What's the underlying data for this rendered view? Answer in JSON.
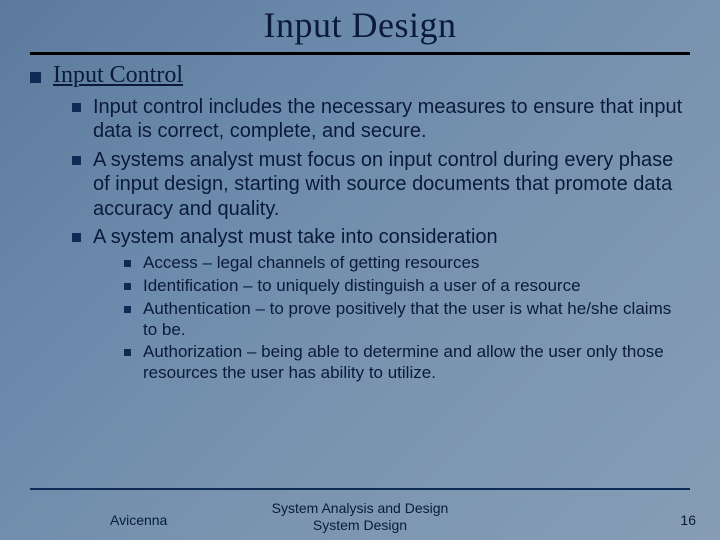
{
  "title": "Input Design",
  "section": "Input Control",
  "bullets": [
    "Input control includes the necessary measures to ensure that input data is correct, complete, and secure.",
    " A systems analyst must focus on input control during every phase of input design, starting with source documents that promote data accuracy and quality.",
    "A system analyst must take into consideration"
  ],
  "subbullets": [
    "Access – legal channels of getting resources",
    "Identification – to uniquely distinguish a user  of a resource",
    "Authentication – to prove positively that the user is what he/she claims to be.",
    "Authorization – being able to determine and allow the user only those resources the user has ability to utilize."
  ],
  "footer": {
    "left": "Avicenna",
    "center_line1": "System Analysis and Design",
    "center_line2": "System Design",
    "page": "16"
  }
}
